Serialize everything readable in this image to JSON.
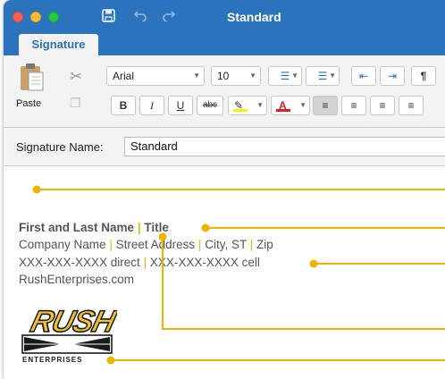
{
  "window": {
    "title": "Standard",
    "tab": "Signature"
  },
  "toolbar": {
    "paste_label": "Paste",
    "font_name": "Arial",
    "font_size": "10",
    "bold": "B",
    "italic": "I",
    "underline": "U",
    "strikethrough": "abc",
    "pilcrow": "¶",
    "highlight_color": "#fff200",
    "font_color": "#e02020"
  },
  "signature_name": {
    "label": "Signature Name:",
    "value": "Standard"
  },
  "signature": {
    "name": "First and Last Name",
    "title": "Title",
    "company": "Company Name",
    "street": "Street Address",
    "city": "City, ST",
    "zip": "Zip",
    "direct": "XXX-XXX-XXXX direct",
    "cell": "XXX-XXX-XXXX cell",
    "website": "RushEnterprises.com",
    "separator": "|"
  },
  "logo": {
    "main": "RUSH",
    "sub": "ENTERPRISES"
  },
  "colors": {
    "accent": "#2b73bd",
    "callout": "#f0b400"
  }
}
